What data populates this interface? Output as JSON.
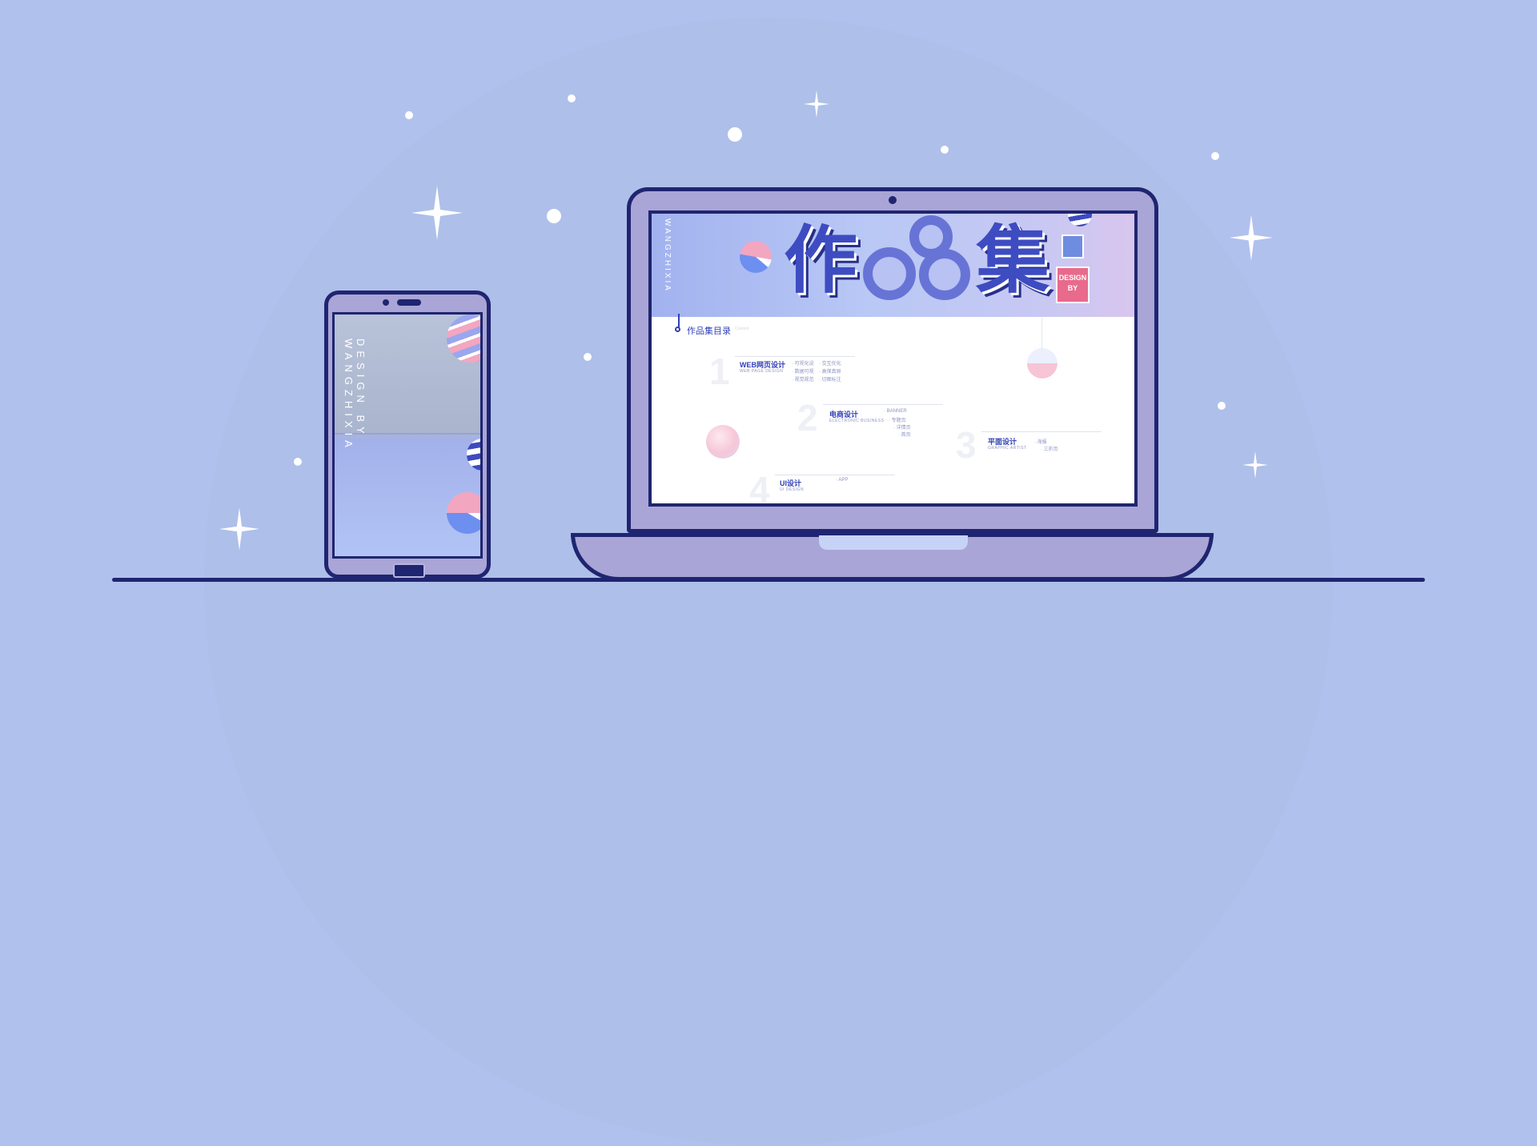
{
  "phone": {
    "vertical_text": "DESIGN BY WANGZHIXIA"
  },
  "laptop": {
    "banner_vertical_text": "WANGZHIXIA",
    "title_chars": [
      "作",
      "集"
    ],
    "badge_line1": "DESIGN",
    "badge_line2": "BY",
    "toc_title": "作品集目录",
    "toc_sub": "Content",
    "sections": [
      {
        "number": "1",
        "title": "WEB网页设计",
        "en": "WEB PAGE DESIGN",
        "items": [
          "· 可视化设",
          "· 交互优化",
          "· 数据可视",
          "· 高保真原",
          "· 视觉规范",
          "· 切图标注"
        ]
      },
      {
        "number": "2",
        "title": "电商设计",
        "en": "ELECTRONIC BUSINESS",
        "items": [
          "· BANNER",
          "· 专题页",
          "· 详情页",
          "· 首页"
        ]
      },
      {
        "number": "3",
        "title": "平面设计",
        "en": "GRAPHIC ARTIST",
        "items": [
          "· 海报",
          "· 三折页"
        ]
      },
      {
        "number": "4",
        "title": "UI设计",
        "en": "UI DESIGN",
        "items": [
          "· APP"
        ]
      }
    ]
  },
  "colors": {
    "background": "#b1c1ee",
    "outline": "#1f2570",
    "device_body": "#a9a5d6",
    "accent_blue": "#3141b5",
    "accent_pink": "#e86a8c"
  }
}
